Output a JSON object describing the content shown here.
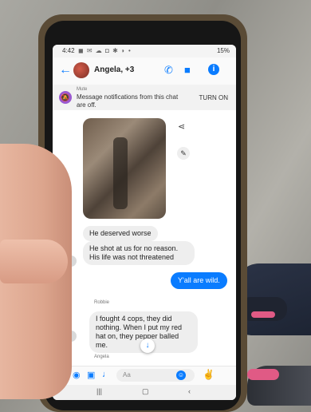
{
  "status_bar": {
    "time": "4:42",
    "icons": "◼ ✉ ☁ ◘ ✱ ◗ •",
    "battery": "15%"
  },
  "header": {
    "back_icon": "back-arrow-icon",
    "title": "Angela, +3",
    "phone_icon": "phone-icon",
    "video_icon": "video-icon",
    "info_icon": "info-icon"
  },
  "mute_banner": {
    "label": "Mute",
    "text": "Message notifications from this chat are off.",
    "action": "TURN ON"
  },
  "messages": [
    {
      "text": "He deserved worse"
    },
    {
      "text": "He shot at us for no reason. His life was not threatened"
    },
    {
      "text": "Y'all are wild."
    },
    {
      "text": "I fought 4 cops, they did nothing. When I put my red hat on, they pepper balled me."
    }
  ],
  "senders": [
    "Robbie",
    "Angela"
  ],
  "composer": {
    "placeholder": "Aa"
  },
  "colors": {
    "accent": "#0a7cff",
    "mute_icon": "#9b59d0"
  }
}
